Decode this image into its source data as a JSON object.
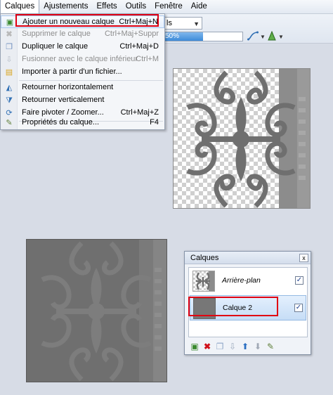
{
  "menubar": {
    "items": [
      "Calques",
      "Ajustements",
      "Effets",
      "Outils",
      "Fenêtre",
      "Aide"
    ]
  },
  "toolbar": {
    "combo_text": "ls",
    "progress_label": "50%",
    "progress_value": 0.5
  },
  "menu": {
    "items": [
      {
        "icon": "add-layer-icon",
        "label": "Ajouter un nouveau calque",
        "shortcut": "Ctrl+Maj+N",
        "enabled": true,
        "highlighted": true
      },
      {
        "icon": "delete-layer-icon",
        "label": "Supprimer le calque",
        "shortcut": "Ctrl+Maj+Suppr",
        "enabled": false
      },
      {
        "icon": "duplicate-layer-icon",
        "label": "Dupliquer le calque",
        "shortcut": "Ctrl+Maj+D",
        "enabled": true
      },
      {
        "icon": "merge-layer-icon",
        "label": "Fusionner avec le calque inférieur",
        "shortcut": "Ctrl+M",
        "enabled": false
      },
      {
        "icon": "import-file-icon",
        "label": "Importer à partir d'un fichier...",
        "shortcut": "",
        "enabled": true
      },
      {
        "icon": "flip-horizontal-icon",
        "label": "Retourner horizontalement",
        "shortcut": "",
        "enabled": true
      },
      {
        "icon": "flip-vertical-icon",
        "label": "Retourner verticalement",
        "shortcut": "",
        "enabled": true
      },
      {
        "icon": "rotate-zoom-icon",
        "label": "Faire pivoter / Zoomer...",
        "shortcut": "Ctrl+Maj+Z",
        "enabled": true
      },
      {
        "icon": "layer-properties-icon",
        "label": "Propriétés du calque...",
        "shortcut": "F4",
        "enabled": true
      }
    ]
  },
  "layers_panel": {
    "title": "Calques",
    "close_glyph": "x",
    "layers": [
      {
        "name": "Arrière-plan",
        "visible": true,
        "selected": false
      },
      {
        "name": "Calque 2",
        "visible": true,
        "selected": true
      }
    ],
    "check_glyph": "✓",
    "tools": [
      "add-layer-icon",
      "delete-layer-icon",
      "duplicate-layer-icon",
      "merge-layer-icon",
      "move-up-icon",
      "move-down-icon",
      "layer-properties-icon"
    ]
  },
  "colors": {
    "highlight_box": "#e00012",
    "ornament": "#6e6e6e",
    "selected_layer": "#c6ddf6"
  }
}
